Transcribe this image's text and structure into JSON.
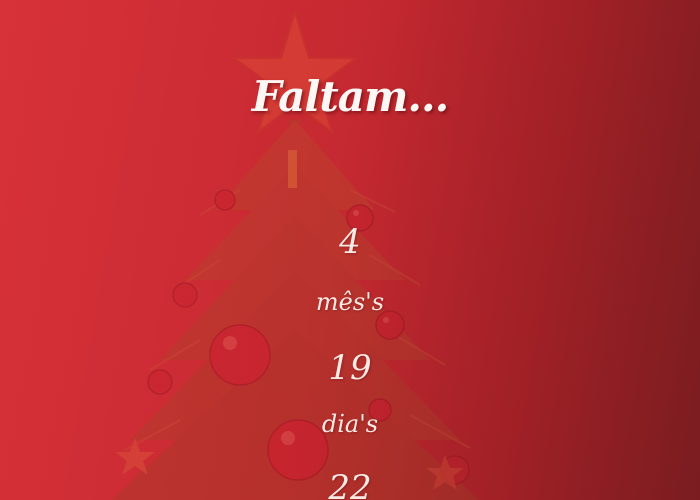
{
  "heading": "Faltam...",
  "countdown": [
    {
      "value": "4",
      "unit": "mês's"
    },
    {
      "value": "19",
      "unit": "dia's"
    },
    {
      "value": "22",
      "unit": ""
    }
  ],
  "colors": {
    "background_start": "#d8323a",
    "background_end": "#7c1d20",
    "text": "#fdf1ef"
  },
  "icons": [
    "christmas-tree-background"
  ]
}
